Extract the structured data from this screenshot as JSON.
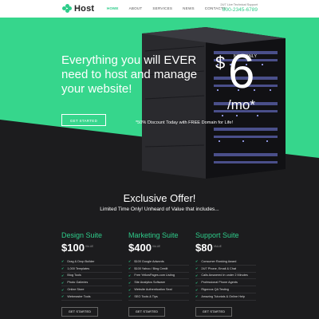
{
  "header": {
    "logo_text": "Host",
    "nav": [
      {
        "label": "HOME",
        "active": true
      },
      {
        "label": "ABOUT",
        "active": false
      },
      {
        "label": "SERVICES",
        "active": false
      },
      {
        "label": "NEWS",
        "active": false
      },
      {
        "label": "CONTACTS",
        "active": false
      }
    ],
    "support_label": "24/7 Live Technical Support",
    "support_phone": "800-2345-6789"
  },
  "hero": {
    "title": "Everything you will EVER need to host and manage your website!",
    "price_tag": "NOW ONLY",
    "price_currency": "$",
    "price_amount": "6",
    "price_period": "/mo*",
    "cta_label": "GET STARTED",
    "discount_text": "*50% Discount Today with FREE Domain for Life!"
  },
  "offer": {
    "title": "Exclusive Offer!",
    "subtitle": "Limited Time Only! Unheard of Value that includes..."
  },
  "plans": [
    {
      "name": "Design Suite",
      "price": "$100",
      "unit": "VALUE",
      "features": [
        "Drag & Drop Builder",
        "1,000 Templates",
        "Blog Tools",
        "Photo Galleries",
        "Online Store",
        "Webmaster Tools"
      ],
      "button": "GET STARTED"
    },
    {
      "name": "Marketing Suite",
      "price": "$400",
      "unit": "VALUE",
      "features": [
        "$100 Google Adwords",
        "$100 Yahoo / Bing Credit",
        "Free YellowPages.com Listing",
        "Site Analytics Software",
        "Website Authentication Seal",
        "SEO Tools & Tips"
      ],
      "button": "GET STARTED"
    },
    {
      "name": "Support Suite",
      "price": "$80",
      "unit": "VALUE",
      "features": [
        "Consumer Ranking Award",
        "24/7 Phone, Email & Chat",
        "Calls Answered in under 2 Minutes",
        "Professional Phone Agents",
        "Rigorous QA Testing",
        "Amazing Tutorials & Online Help"
      ],
      "button": "GET STARTED"
    }
  ],
  "colors": {
    "accent": "#36d68c",
    "dark_bg": "#1c1c1e",
    "text_light": "#ffffff"
  }
}
